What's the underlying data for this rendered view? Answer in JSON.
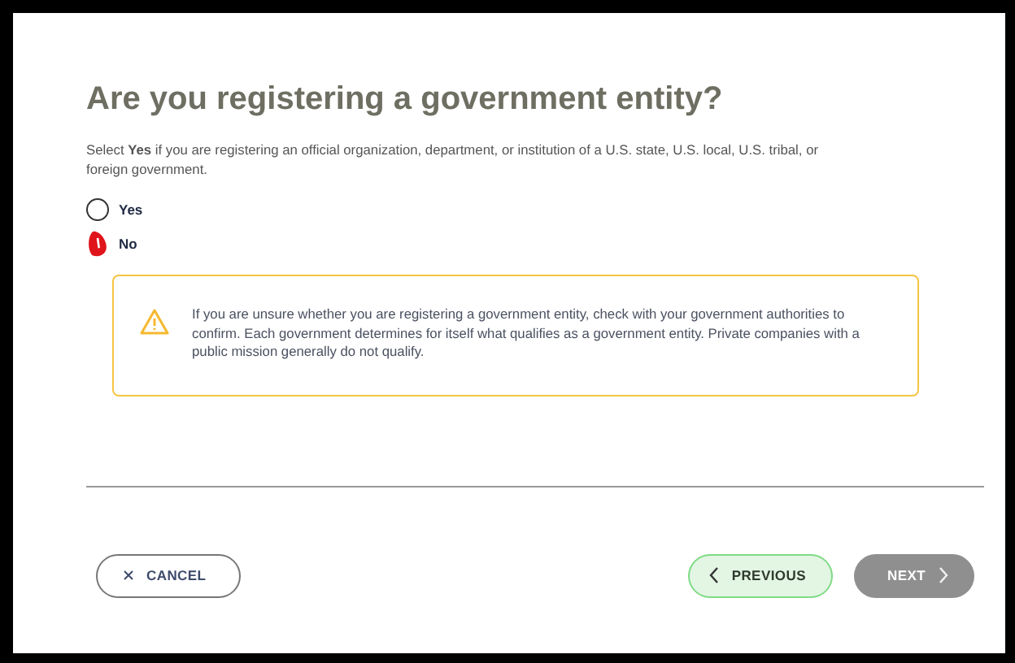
{
  "title": "Are you registering a government entity?",
  "description": "Select **Yes** if you are registering an official organization, department, or institution of a U.S. state, U.S. local, U.S. tribal, or foreign government.",
  "options": [
    {
      "label": "Yes",
      "selected": false
    },
    {
      "label": "No",
      "selected": true
    }
  ],
  "alert": {
    "text": "If you are unsure whether you are registering a government entity, check with your government authorities to confirm. Each government determines for itself what qualifies as a government entity. Private companies with a public mission generally do not qualify."
  },
  "buttons": [
    {
      "kind": "cancel",
      "label": "CANCEL",
      "disabled": false
    },
    {
      "kind": "previous",
      "label": "PREVIOUS",
      "disabled": false
    },
    {
      "kind": "next",
      "label": "NEXT",
      "disabled": true
    }
  ]
}
